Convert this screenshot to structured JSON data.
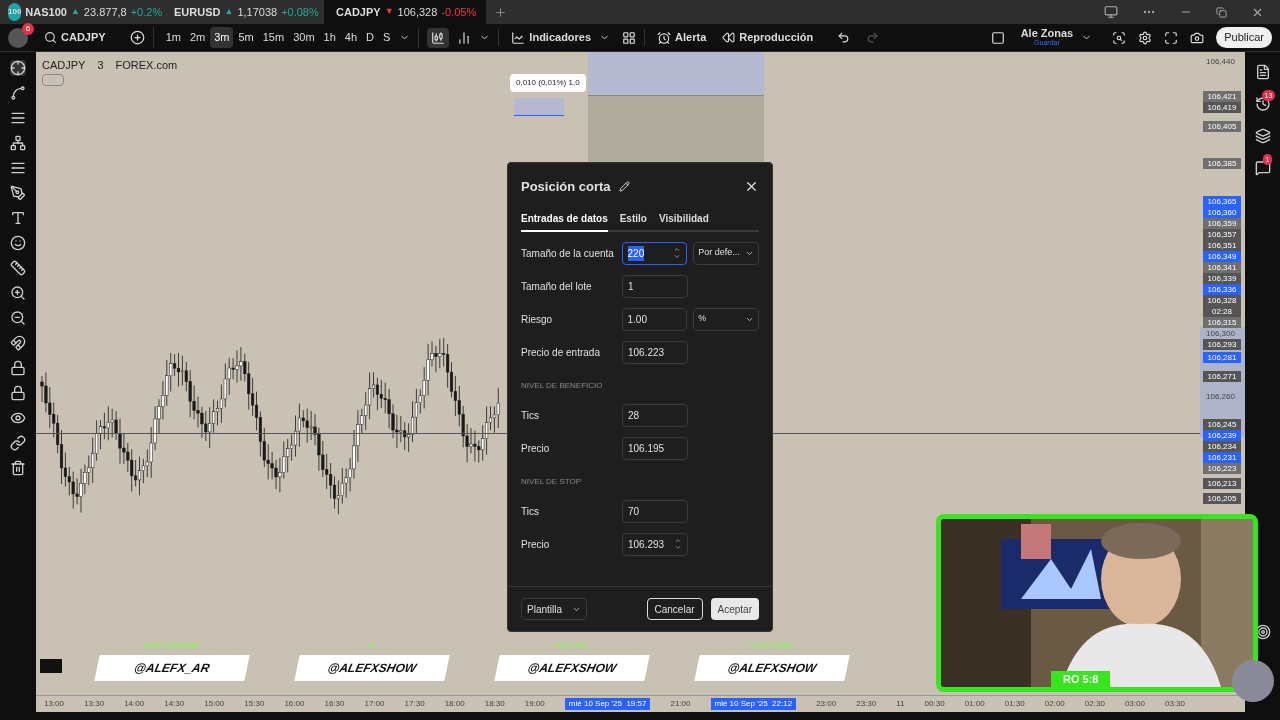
{
  "tabs": [
    {
      "symbol": "NAS100",
      "badge": "100",
      "arrow": "▲",
      "color": "#26a69a",
      "price": "23.877,8",
      "change": "+0.2%",
      "selected": false
    },
    {
      "symbol": "EURUSD",
      "arrow": "▲",
      "color": "#26a69a",
      "price": "1,17038",
      "change": "+0.08%",
      "selected": false
    },
    {
      "symbol": "CADJPY",
      "arrow": "▼",
      "color": "#f23645",
      "price": "106,328",
      "change": "-0.05%",
      "selected": true
    }
  ],
  "toolbar": {
    "notifications": "6",
    "symbol": "CADJPY",
    "intervals": [
      {
        "label": "1m",
        "selected": false
      },
      {
        "label": "2m",
        "selected": false
      },
      {
        "label": "3m",
        "selected": true
      },
      {
        "label": "5m",
        "selected": false
      },
      {
        "label": "15m",
        "selected": false
      },
      {
        "label": "30m",
        "selected": false
      },
      {
        "label": "1h",
        "selected": false
      },
      {
        "label": "4h",
        "selected": false
      },
      {
        "label": "D",
        "selected": false
      },
      {
        "label": "S",
        "selected": false
      }
    ],
    "indicators": "Indicadores",
    "alert": "Alerta",
    "replay": "Reproducción",
    "layout_name": "Ale Zonas",
    "layout_status": "Guardar",
    "publish": "Publicar"
  },
  "chart": {
    "legend": [
      "CADJPY",
      "3",
      "FOREX.com"
    ],
    "tooltip": "0,010 (0,01%) 1,0"
  },
  "price_axis": [
    {
      "label": "106,440",
      "kind": "plain"
    },
    {
      "label": "106,421",
      "kind": "box",
      "color": "#6f6f6f"
    },
    {
      "label": "106,419",
      "kind": "box",
      "color": "#555555"
    },
    {
      "label": "106,405",
      "kind": "box",
      "color": "#6f6f6f"
    },
    {
      "label": "106,385",
      "kind": "box",
      "color": "#6f6f6f"
    },
    {
      "label": "106,365",
      "kind": "box",
      "color": "#2962ff"
    },
    {
      "label": "106,360",
      "kind": "box",
      "color": "#2962ff"
    },
    {
      "label": "106,359",
      "kind": "box",
      "color": "#6f6f6f"
    },
    {
      "label": "106,357",
      "kind": "box",
      "color": "#555555"
    },
    {
      "label": "106,351",
      "kind": "box",
      "color": "#555555"
    },
    {
      "label": "106,349",
      "kind": "box",
      "color": "#2962ff"
    },
    {
      "label": "106,341",
      "kind": "box",
      "color": "#6f6f6f"
    },
    {
      "label": "106,339",
      "kind": "box",
      "color": "#555555"
    },
    {
      "label": "106,336",
      "kind": "box",
      "color": "#2962ff"
    },
    {
      "label": "106,328",
      "kind": "current",
      "color": "#555555",
      "countdown": "02:28"
    },
    {
      "label": "106,315",
      "kind": "box",
      "color": "#6f6f6f"
    },
    {
      "label": "106,300",
      "kind": "plain"
    },
    {
      "label": "106,293",
      "kind": "box",
      "color": "#555555"
    },
    {
      "label": "106,281",
      "kind": "box",
      "color": "#2962ff"
    },
    {
      "label": "106,271",
      "kind": "box",
      "color": "#555555"
    },
    {
      "label": "106,260",
      "kind": "plain"
    },
    {
      "label": "106,245",
      "kind": "box",
      "color": "#555555"
    },
    {
      "label": "106,239",
      "kind": "box",
      "color": "#2962ff"
    },
    {
      "label": "106,234",
      "kind": "box",
      "color": "#555555"
    },
    {
      "label": "106,231",
      "kind": "box",
      "color": "#2962ff"
    },
    {
      "label": "106,223",
      "kind": "box",
      "color": "#6f6f6f"
    },
    {
      "label": "106,213",
      "kind": "box",
      "color": "#555555"
    },
    {
      "label": "106,205",
      "kind": "box",
      "color": "#555555"
    }
  ],
  "time_axis": [
    {
      "label": "13:00",
      "kind": "tick"
    },
    {
      "label": "13:30",
      "kind": "tick"
    },
    {
      "label": "14:00",
      "kind": "tick"
    },
    {
      "label": "14:30",
      "kind": "tick"
    },
    {
      "label": "15:00",
      "kind": "tick"
    },
    {
      "label": "15:30",
      "kind": "tick"
    },
    {
      "label": "16:00",
      "kind": "tick"
    },
    {
      "label": "16:30",
      "kind": "tick"
    },
    {
      "label": "17:00",
      "kind": "tick"
    },
    {
      "label": "17:30",
      "kind": "tick"
    },
    {
      "label": "18:00",
      "kind": "tick"
    },
    {
      "label": "18:30",
      "kind": "tick"
    },
    {
      "label": "19:00",
      "kind": "tick"
    },
    {
      "label": "mié 10 Sep '25  19:57",
      "kind": "marker"
    },
    {
      "label": "21:00",
      "kind": "tick"
    },
    {
      "label": "mié 10 Sep '25  22:12",
      "kind": "marker"
    },
    {
      "label": "23:00",
      "kind": "tick"
    },
    {
      "label": "23:30",
      "kind": "tick"
    },
    {
      "label": "11",
      "kind": "tick"
    },
    {
      "label": "00:30",
      "kind": "tick"
    },
    {
      "label": "01:00",
      "kind": "tick"
    },
    {
      "label": "01:30",
      "kind": "tick"
    },
    {
      "label": "02:00",
      "kind": "tick"
    },
    {
      "label": "02:30",
      "kind": "tick"
    },
    {
      "label": "03:00",
      "kind": "tick"
    },
    {
      "label": "03:30",
      "kind": "tick"
    }
  ],
  "sidebar_badges": {
    "alerts": "13",
    "chat": "1"
  },
  "dialog": {
    "title": "Posición corta",
    "tabs": [
      {
        "label": "Entradas de datos",
        "selected": true
      },
      {
        "label": "Estilo",
        "selected": false
      },
      {
        "label": "Visibilidad",
        "selected": false
      }
    ],
    "rows": [
      {
        "kind": "field",
        "label": "Tamaño de la cuenta",
        "value": "220",
        "focused": true,
        "spinner": true,
        "select": "Por defe..."
      },
      {
        "kind": "field",
        "label": "Tamaño del lote",
        "value": "1",
        "focused": false,
        "spinner": false
      },
      {
        "kind": "field",
        "label": "Riesgo",
        "value": "1.00",
        "focused": false,
        "spinner": false,
        "select": "%"
      },
      {
        "kind": "field",
        "label": "Precio de entrada",
        "value": "106.223",
        "focused": false,
        "spinner": false
      },
      {
        "kind": "section",
        "label": "NIVEL DE BENEFICIO"
      },
      {
        "kind": "field",
        "label": "Tics",
        "value": "28",
        "focused": false,
        "spinner": false
      },
      {
        "kind": "field",
        "label": "Precio",
        "value": "106.195",
        "focused": false,
        "spinner": false
      },
      {
        "kind": "section",
        "label": "NIVEL DE STOP"
      },
      {
        "kind": "field",
        "label": "Tics",
        "value": "70",
        "focused": false,
        "spinner": false
      },
      {
        "kind": "field",
        "label": "Precio",
        "value": "106.293",
        "focused": false,
        "spinner": true
      }
    ],
    "template": "Plantilla",
    "cancel": "Cancelar",
    "accept": "Aceptar"
  },
  "socials": [
    {
      "network": "INSTAGRAM",
      "handle": "@ALEFX_AR"
    },
    {
      "network": "X",
      "handle": "@ALEFXSHOW"
    },
    {
      "network": "TIKTOK",
      "handle": "@ALEFXSHOW"
    },
    {
      "network": "YOUTUBE",
      "handle": "@ALEFXSHOW"
    }
  ],
  "webcam": {
    "kind": "picture",
    "caption": "RO 5:8"
  }
}
